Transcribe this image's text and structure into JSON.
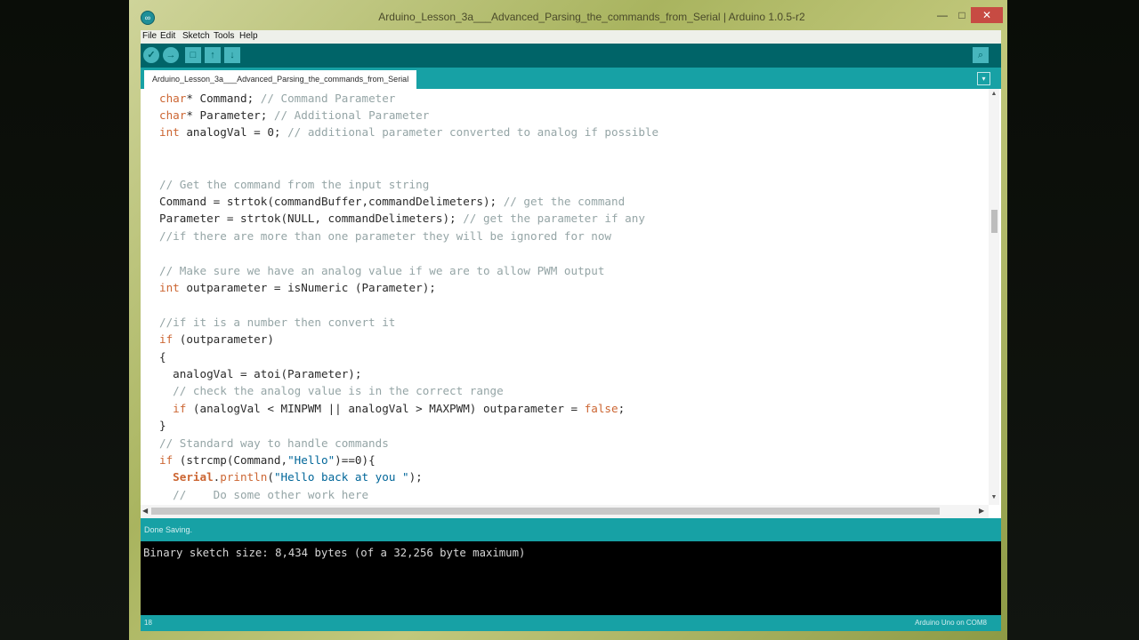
{
  "window": {
    "title": "Arduino_Lesson_3a___Advanced_Parsing_the_commands_from_Serial | Arduino 1.0.5-r2",
    "min_glyph": "—",
    "max_glyph": "□",
    "close_glyph": "✕"
  },
  "menu": {
    "items": [
      "File",
      "Edit",
      "Sketch",
      "Tools",
      "Help"
    ]
  },
  "toolbar": {
    "icons": [
      "verify-icon",
      "upload-icon",
      "new-icon",
      "open-icon",
      "save-icon",
      "serial-monitor-icon"
    ],
    "verify_glyph": "✓",
    "upload_glyph": "→",
    "new_glyph": "□",
    "open_glyph": "↑",
    "save_glyph": "↓",
    "serial_glyph": "⌕"
  },
  "tabs": {
    "active": "Arduino_Lesson_3a___Advanced_Parsing_the_commands_from_Serial",
    "menu_glyph": "▾"
  },
  "code": {
    "lines": [
      [
        {
          "t": "char",
          "c": "kw"
        },
        {
          "t": "* Command; "
        },
        {
          "t": "// Command Parameter",
          "c": "cm"
        }
      ],
      [
        {
          "t": "char",
          "c": "kw"
        },
        {
          "t": "* Parameter; "
        },
        {
          "t": "// Additional Parameter",
          "c": "cm"
        }
      ],
      [
        {
          "t": "int",
          "c": "kw"
        },
        {
          "t": " analogVal = 0; "
        },
        {
          "t": "// additional parameter converted to analog if possible",
          "c": "cm"
        }
      ],
      [
        {
          "t": ""
        }
      ],
      [
        {
          "t": ""
        }
      ],
      [
        {
          "t": "// Get the command from the input string",
          "c": "cm"
        }
      ],
      [
        {
          "t": "Command = strtok(commandBuffer,commandDelimeters); "
        },
        {
          "t": "// get the command",
          "c": "cm"
        }
      ],
      [
        {
          "t": "Parameter = strtok(NULL, commandDelimeters); "
        },
        {
          "t": "// get the parameter if any",
          "c": "cm"
        }
      ],
      [
        {
          "t": "//if there are more than one parameter they will be ignored for now",
          "c": "cm"
        }
      ],
      [
        {
          "t": ""
        }
      ],
      [
        {
          "t": "// Make sure we have an analog value if we are to allow PWM output",
          "c": "cm"
        }
      ],
      [
        {
          "t": "int",
          "c": "kw"
        },
        {
          "t": " outparameter = isNumeric (Parameter);"
        }
      ],
      [
        {
          "t": ""
        }
      ],
      [
        {
          "t": "//if it is a number then convert it",
          "c": "cm"
        }
      ],
      [
        {
          "t": "if",
          "c": "kw"
        },
        {
          "t": " (outparameter)"
        }
      ],
      [
        {
          "t": "{"
        }
      ],
      [
        {
          "t": "  analogVal = atoi(Parameter);"
        }
      ],
      [
        {
          "t": "  "
        },
        {
          "t": "// check the analog value is in the correct range",
          "c": "cm"
        }
      ],
      [
        {
          "t": "  "
        },
        {
          "t": "if",
          "c": "kw"
        },
        {
          "t": " (analogVal < MINPWM || analogVal > MAXPWM) outparameter = "
        },
        {
          "t": "false",
          "c": "kw"
        },
        {
          "t": ";"
        }
      ],
      [
        {
          "t": "}"
        }
      ],
      [
        {
          "t": "// Standard way to handle commands",
          "c": "cm"
        }
      ],
      [
        {
          "t": "if",
          "c": "kw"
        },
        {
          "t": " (strcmp(Command,"
        },
        {
          "t": "\"Hello\"",
          "c": "st"
        },
        {
          "t": ")==0){"
        }
      ],
      [
        {
          "t": "  "
        },
        {
          "t": "Serial",
          "c": "cls"
        },
        {
          "t": "."
        },
        {
          "t": "println",
          "c": "fn"
        },
        {
          "t": "("
        },
        {
          "t": "\"Hello back at you \"",
          "c": "st"
        },
        {
          "t": ");"
        }
      ],
      [
        {
          "t": "  "
        },
        {
          "t": "//    Do some other work here",
          "c": "cm"
        }
      ]
    ]
  },
  "status": {
    "message": "Done Saving."
  },
  "console": {
    "output": "Binary sketch size: 8,434 bytes (of a 32,256 byte maximum)"
  },
  "footer": {
    "line_number": "18",
    "board": "Arduino Uno on COM8"
  },
  "scroll": {
    "up_glyph": "▲",
    "down_glyph": "▼",
    "left_glyph": "◀",
    "right_glyph": "▶"
  }
}
